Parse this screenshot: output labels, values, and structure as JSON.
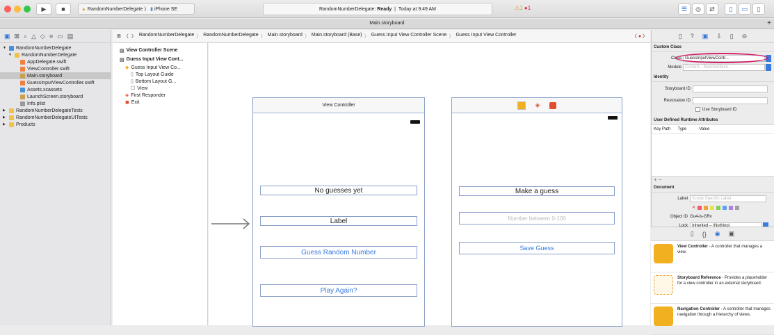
{
  "toolbar": {
    "scheme_label": "RandomNumberDelegate",
    "device_label": "iPhone SE",
    "status_project": "RandomNumberDelegate:",
    "status_state": "Ready",
    "status_time": "Today at 9:49 AM",
    "warnings": "⚠1",
    "errors": "1"
  },
  "tab_title": "Main.storyboard",
  "navigator": {
    "items": [
      {
        "label": "RandomNumberDelegate",
        "level": 0,
        "color": "#4a90d9"
      },
      {
        "label": "RandomNumberDelegate",
        "level": 1,
        "color": "#f0c24a"
      },
      {
        "label": "AppDelegate.swift",
        "level": 2,
        "color": "#f08040"
      },
      {
        "label": "ViewController.swift",
        "level": 2,
        "color": "#f08040"
      },
      {
        "label": "Main.storyboard",
        "level": 2,
        "color": "#c8a050"
      },
      {
        "label": "GuessInputViewController.swift",
        "level": 2,
        "color": "#f08040"
      },
      {
        "label": "Assets.xcassets",
        "level": 2,
        "color": "#4a90d9"
      },
      {
        "label": "LaunchScreen.storyboard",
        "level": 2,
        "color": "#c8a050"
      },
      {
        "label": "Info.plist",
        "level": 2,
        "color": "#999999"
      },
      {
        "label": "RandomNumberDelegateTests",
        "level": 0,
        "color": "#f0c24a"
      },
      {
        "label": "RandomNumberDelegateUITests",
        "level": 0,
        "color": "#f0c24a"
      },
      {
        "label": "Products",
        "level": 0,
        "color": "#f0c24a"
      }
    ]
  },
  "jumpbar": {
    "crumbs": [
      "RandomNumberDelegate",
      "RandomNumberDelegate",
      "Main.storyboard",
      "Main.storyboard (Base)",
      "Guess Input View Controller Scene",
      "Guess Input View Controller"
    ]
  },
  "outline": {
    "items": [
      {
        "label": "View Controller Scene",
        "indent": 0
      },
      {
        "label": "Guess Input View Cont...",
        "indent": 0
      },
      {
        "label": "Guess Input View Co...",
        "indent": 1
      },
      {
        "label": "Top Layout Guide",
        "indent": 2
      },
      {
        "label": "Bottom Layout G...",
        "indent": 2
      },
      {
        "label": "View",
        "indent": 2
      },
      {
        "label": "First Responder",
        "indent": 1
      },
      {
        "label": "Exit",
        "indent": 1
      }
    ]
  },
  "scene1": {
    "title": "View Controller",
    "label1": "No guesses yet",
    "label2": "Label",
    "button1": "Guess Random Number",
    "button2": "Play Again?"
  },
  "scene2": {
    "label1": "Make a guess",
    "placeholder": "Number between 0-100",
    "button1": "Save Guess"
  },
  "inspector": {
    "custom_class_title": "Custom Class",
    "class_label": "Class",
    "class_value": "GuessInputViewContr...",
    "module_label": "Module",
    "module_value": "Current – RandomNum...",
    "identity_title": "Identity",
    "storyboard_id_label": "Storyboard ID",
    "restoration_id_label": "Restoration ID",
    "use_storyboard_id": "Use Storyboard ID",
    "udra_title": "User Defined Runtime Attributes",
    "col_keypath": "Key Path",
    "col_type": "Type",
    "col_value": "Value",
    "document_title": "Document",
    "doc_label_label": "Label",
    "doc_label_placeholder": "Xcode Specific Label",
    "object_id_label": "Object ID",
    "object_id_value": "Gu4-is-GRv",
    "lock_label": "Lock",
    "lock_value": "Inherited – (Nothing)"
  },
  "library": [
    {
      "title": "View Controller",
      "desc": " - A controller that manages a view.",
      "color": "#f0b020"
    },
    {
      "title": "Storyboard Reference",
      "desc": " - Provides a placeholder for a view controller in an external storyboard.",
      "color": "#f6d58a"
    },
    {
      "title": "Navigation Controller",
      "desc": " - A controller that manages navigation through a hierarchy of views.",
      "color": "#f0b020"
    }
  ]
}
